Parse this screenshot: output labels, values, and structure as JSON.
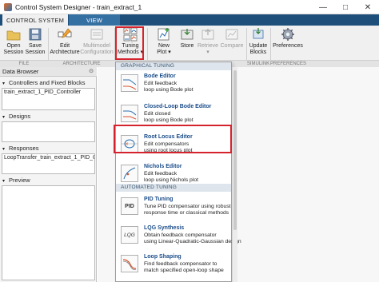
{
  "window": {
    "title": "Control System Designer - train_extract_1",
    "minimize_glyph": "—",
    "maximize_glyph": "□",
    "close_glyph": "✕"
  },
  "tabs": [
    "CONTROL SYSTEM",
    "VIEW"
  ],
  "ribbon": {
    "buttons": {
      "open": "Open\nSession",
      "save": "Save\nSession",
      "edit_arch": "Edit\nArchitecture",
      "multimodel": "Multimodel\nConfiguration",
      "tuning": "Tuning\nMethods ▾",
      "new_plot": "New\nPlot ▾",
      "store": "Store",
      "retrieve": "Retrieve\n▾",
      "compare": "Compare",
      "update_blocks": "Update\nBlocks",
      "preferences": "Preferences"
    },
    "groups": {
      "file": "FILE",
      "architecture": "ARCHITECTURE",
      "simulink": "SIMULINK",
      "preferences": "PREFERENCES"
    }
  },
  "data_browser": {
    "title": "Data Browser",
    "sections": {
      "controllers": "Controllers and Fixed Blocks",
      "designs": "Designs",
      "responses": "Responses",
      "preview": "Preview"
    },
    "controller_items": [
      "train_extract_1_PID_Controller"
    ],
    "response_items": [
      "LoopTransfer_train_extract_1_PID_Co..."
    ]
  },
  "tuning_menu": {
    "graphical_header": "GRAPHICAL TUNING",
    "automated_header": "AUTOMATED TUNING",
    "graphical": [
      {
        "title": "Bode Editor",
        "desc": "Edit feedback\nloop using Bode plot"
      },
      {
        "title": "Closed-Loop Bode Editor",
        "desc": "Edit closed\nloop using Bode plot"
      },
      {
        "title": "Root Locus Editor",
        "desc": "Edit compensators\nusing root locus plot"
      },
      {
        "title": "Nichols Editor",
        "desc": "Edit feedback\nloop using Nichols plot"
      }
    ],
    "automated": [
      {
        "title": "PID Tuning",
        "desc": "Tune PID compensator using robust\nresponse time or classical methods",
        "icon_text": "PID"
      },
      {
        "title": "LQG Synthesis",
        "desc": "Obtain feedback compensator\nusing Linear-Quadratic-Gaussian design",
        "icon_text": "LQG"
      },
      {
        "title": "Loop Shaping",
        "desc": "Find feedback compensator to\nmatch specified open-loop shape"
      }
    ]
  },
  "colors": {
    "highlight": "#d4232d",
    "tab_bar": "#1e4f7a",
    "menu_title": "#1a4c8a"
  }
}
